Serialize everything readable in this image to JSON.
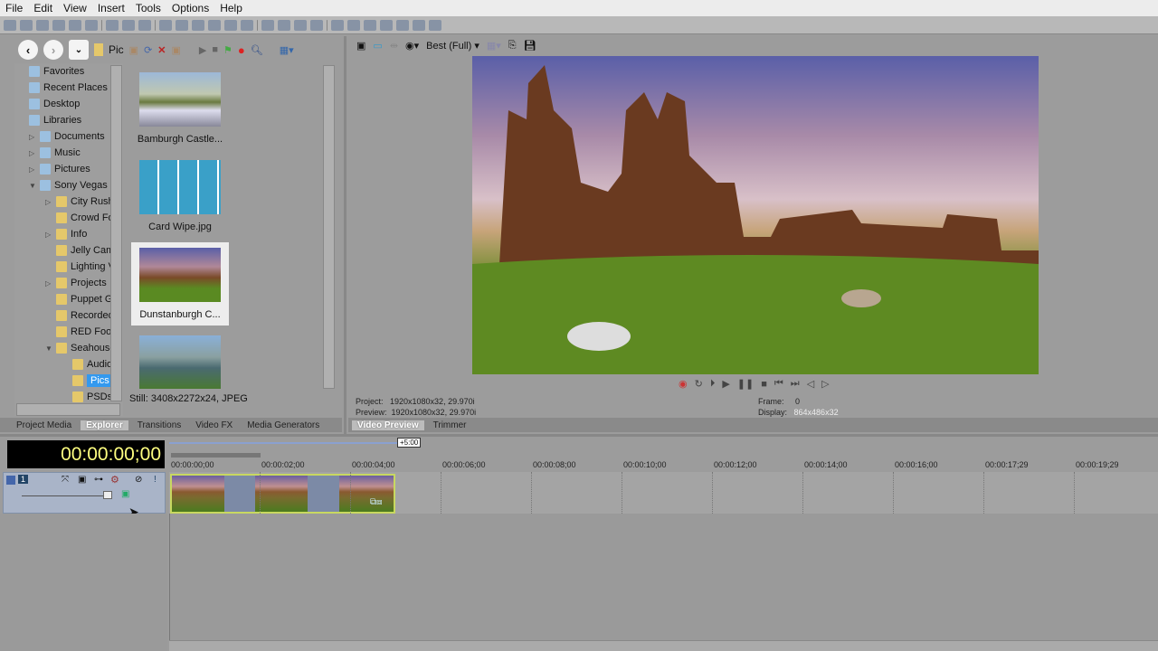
{
  "menu": [
    "File",
    "Edit",
    "View",
    "Insert",
    "Tools",
    "Options",
    "Help"
  ],
  "explorer": {
    "path_label": "Pic",
    "tree": [
      {
        "label": "Favorites",
        "level": 0,
        "expand": ""
      },
      {
        "label": "Recent Places",
        "level": 0,
        "expand": ""
      },
      {
        "label": "Desktop",
        "level": 0,
        "expand": ""
      },
      {
        "label": "Libraries",
        "level": 0,
        "expand": ""
      },
      {
        "label": "Documents",
        "level": 1,
        "expand": "▷"
      },
      {
        "label": "Music",
        "level": 1,
        "expand": "▷"
      },
      {
        "label": "Pictures",
        "level": 1,
        "expand": "▷"
      },
      {
        "label": "Sony Vegas",
        "level": 1,
        "expand": "▼"
      },
      {
        "label": "City Rush",
        "level": 2,
        "expand": "▷"
      },
      {
        "label": "Crowd Fo",
        "level": 2,
        "expand": ""
      },
      {
        "label": "Info",
        "level": 2,
        "expand": "▷"
      },
      {
        "label": "Jelly Cam",
        "level": 2,
        "expand": ""
      },
      {
        "label": "Lighting V",
        "level": 2,
        "expand": ""
      },
      {
        "label": "Projects",
        "level": 2,
        "expand": "▷"
      },
      {
        "label": "Puppet G",
        "level": 2,
        "expand": ""
      },
      {
        "label": "Recorded",
        "level": 2,
        "expand": ""
      },
      {
        "label": "RED Foot",
        "level": 2,
        "expand": ""
      },
      {
        "label": "Seahouse",
        "level": 2,
        "expand": "▼"
      },
      {
        "label": "Audio",
        "level": 3,
        "expand": ""
      },
      {
        "label": "Pics",
        "level": 3,
        "expand": "",
        "selected": true
      },
      {
        "label": "PSDs",
        "level": 3,
        "expand": ""
      }
    ],
    "files": [
      {
        "name": "Bamburgh Castle..."
      },
      {
        "name": "Card Wipe.jpg"
      },
      {
        "name": "Dunstanburgh C...",
        "selected": true
      },
      {
        "name": ""
      }
    ],
    "status": "Still: 3408x2272x24, JPEG"
  },
  "left_tabs": [
    "Project Media",
    "Explorer",
    "Transitions",
    "Video FX",
    "Media Generators"
  ],
  "preview": {
    "quality": "Best (Full)",
    "project": "Project:   1920x1080x32, 29.970i",
    "preview": "Preview:  1920x1080x32, 29.970i",
    "frame": "Frame:     0",
    "display_label": "Display:",
    "display_value": "864x486x32"
  },
  "right_tabs": [
    "Video Preview",
    "Trimmer"
  ],
  "timeline": {
    "timecode": "00:00:00;00",
    "marker": "+5:00",
    "track_number": "1",
    "ruler": [
      "00:00:00;00",
      "00:00:02;00",
      "00:00:04;00",
      "00:00:06;00",
      "00:00:08;00",
      "00:00:10;00",
      "00:00:12;00",
      "00:00:14;00",
      "00:00:16;00",
      "00:00:17;29",
      "00:00:19;29"
    ]
  },
  "colors": {
    "accent": "#3399ee",
    "timecode": "#ffff80",
    "clip_border": "#c8d860"
  }
}
